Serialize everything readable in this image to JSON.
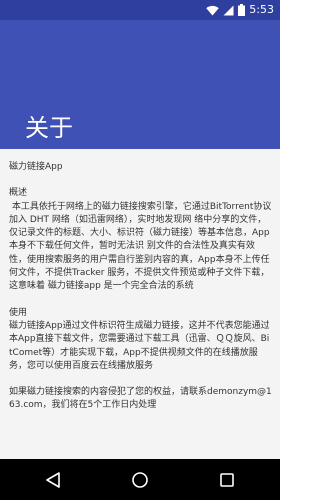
{
  "status_bar": {
    "time": "5:53",
    "icons": [
      "wifi-icon",
      "cellular-signal-icon",
      "battery-icon"
    ]
  },
  "app_bar": {
    "title": "关于"
  },
  "content": {
    "heading": "磁力链接App",
    "overview_title": "概述",
    "overview_text": " 本工具依托于网络上的磁力链接搜索引擎，它通过BitTorrent协议加入 DHT 网络（如迅雷网络），实时地发现网 络中分享的文件，仅记录文件的标题、大小、标识符（磁力链接）等基本信息，App本身不下载任何文件，暂时无法识 别文件的合法性及真实有效性，使用搜索服务的用户需自行鉴别内容的真，App本身不上传任何文件，不提供Tracker 服务，不提供文件预览或种子文件下载，这意味着 磁力链接app 是一个完全合法的系统",
    "usage_title": "使用",
    "usage_text": "磁力链接App通过文件标识符生成磁力链接，这并不代表您能通过本App直接下载文件，您需要通过下载工具（迅雷、ＱＱ旋风、BitComet等）才能实现下载，App不提供视频文件的在线播放服务，您可以使用百度云在线播放服务",
    "contact_text": "如果磁力链接搜索的内容侵犯了您的权益，请联系demonzym@163.com，我们将在5个工作日内处理"
  },
  "nav_bar": {
    "buttons": [
      "back-icon",
      "home-icon",
      "recents-icon"
    ]
  },
  "colors": {
    "status_bar": "#2f3f9f",
    "app_bar": "#3f51b5",
    "content_bg": "#f4f4f4",
    "nav_bar": "#000000"
  }
}
